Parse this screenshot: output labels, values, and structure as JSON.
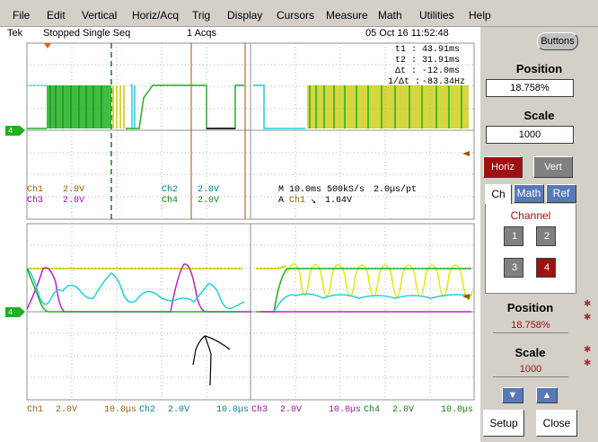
{
  "menu": [
    "File",
    "Edit",
    "Vertical",
    "Horiz/Acq",
    "Trig",
    "Display",
    "Cursors",
    "Measure",
    "Math",
    "Utilities",
    "Help"
  ],
  "status": {
    "brand": "Tek",
    "state": "Stopped",
    "mode": "Single Seq",
    "acqs": "1 Acqs",
    "datetime": "05 Oct 16 11:52:48"
  },
  "cursor_readout": {
    "t1_label": "t1 :",
    "t1": "43.91ms",
    "t2_label": "t2 :",
    "t2": "31.91ms",
    "dt_label": "Δt :",
    "dt": "-12.0ms",
    "inv_label": "1/Δt :",
    "inv": "-83.34Hz"
  },
  "channel_settings": {
    "ch1_label": "Ch1",
    "ch1_scale": "2.0V",
    "ch2_label": "Ch2",
    "ch2_scale": "2.0V",
    "ch3_label": "Ch3",
    "ch3_scale": "2.0V",
    "ch4_label": "Ch4",
    "ch4_scale": "2.0V"
  },
  "timebase": {
    "main": "M 10.0ms 500kS/s",
    "per_pt": "2.0µs/pt",
    "trigger_prefix": "A",
    "trigger_ch": "Ch1",
    "trigger_slope": "↘",
    "trigger_level": "1.64V"
  },
  "ground_marker": "4",
  "bottom_bar": [
    {
      "ch": "Ch1",
      "scale": "2.0V",
      "time": "10.0µs"
    },
    {
      "ch": "Ch2",
      "scale": "2.0V",
      "time": "10.0µs"
    },
    {
      "ch": "Ch3",
      "scale": "2.0V",
      "time": "10.0µs"
    },
    {
      "ch": "Ch4",
      "scale": "2.0V",
      "time": "10.0µs"
    }
  ],
  "panel": {
    "buttons_label": "Buttons",
    "position_title": "Position",
    "position_value": "18.758%",
    "scale_title": "Scale",
    "scale_value": "1000",
    "horiz": "Horiz",
    "vert": "Vert",
    "tabs": [
      "Ch",
      "Math",
      "Ref"
    ],
    "channel_title": "Channel",
    "channels": [
      "1",
      "2",
      "3",
      "4"
    ],
    "position2_title": "Position",
    "position2_value": "18.758%",
    "scale2_title": "Scale",
    "scale2_value": "1000",
    "setup": "Setup",
    "close": "Close"
  },
  "colors": {
    "ch1": "#c8c800",
    "ch2": "#20d0e0",
    "ch3": "#c020c0",
    "ch4": "#20b020",
    "accent": "#a01010"
  }
}
